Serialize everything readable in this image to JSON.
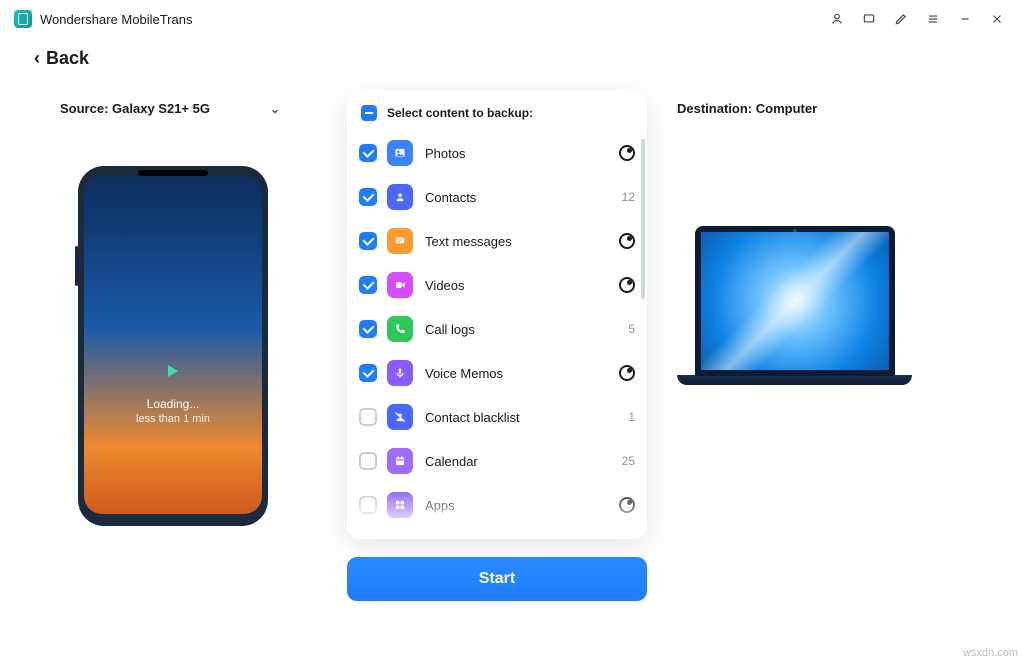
{
  "app": {
    "title": "Wondershare MobileTrans"
  },
  "nav": {
    "back": "Back"
  },
  "source": {
    "prefix": "Source:",
    "name": "Galaxy S21+ 5G"
  },
  "destination": {
    "prefix": "Destination:",
    "name": "Computer"
  },
  "phone": {
    "status": "Loading...",
    "eta": "less than 1 min"
  },
  "panel": {
    "heading": "Select content to backup:",
    "start": "Start"
  },
  "items": [
    {
      "label": "Photos",
      "checked": true,
      "icon": "photos",
      "color": "#3a82ff",
      "count": null,
      "loading": true
    },
    {
      "label": "Contacts",
      "checked": true,
      "icon": "contacts",
      "color": "#4a68ff",
      "count": "12",
      "loading": false
    },
    {
      "label": "Text messages",
      "checked": true,
      "icon": "sms",
      "color": "#ff9a2e",
      "count": null,
      "loading": true
    },
    {
      "label": "Videos",
      "checked": true,
      "icon": "videos",
      "color": "#d64dff",
      "count": null,
      "loading": true
    },
    {
      "label": "Call logs",
      "checked": true,
      "icon": "calls",
      "color": "#2ec85a",
      "count": "5",
      "loading": false
    },
    {
      "label": "Voice Memos",
      "checked": true,
      "icon": "voice",
      "color": "#8a5bff",
      "count": null,
      "loading": true
    },
    {
      "label": "Contact blacklist",
      "checked": false,
      "icon": "blacklist",
      "color": "#4a68ff",
      "count": "1",
      "loading": false
    },
    {
      "label": "Calendar",
      "checked": false,
      "icon": "calendar",
      "color": "#a06bff",
      "count": "25",
      "loading": false
    },
    {
      "label": "Apps",
      "checked": false,
      "icon": "apps",
      "color": "#8a5bff",
      "count": null,
      "loading": true
    }
  ],
  "watermark": "wsxdn.com"
}
